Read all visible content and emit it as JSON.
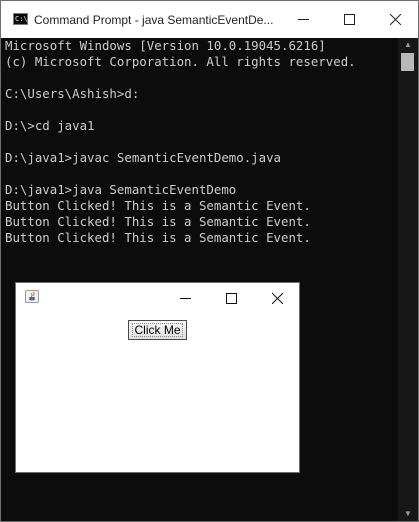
{
  "cmd_window": {
    "title": "Command Prompt - java  SemanticEventDe...",
    "icon": "cmd-icon",
    "console_lines": [
      "Microsoft Windows [Version 10.0.19045.6216]",
      "(c) Microsoft Corporation. All rights reserved.",
      "",
      "C:\\Users\\Ashish>d:",
      "",
      "D:\\>cd java1",
      "",
      "D:\\java1>javac SemanticEventDemo.java",
      "",
      "D:\\java1>java SemanticEventDemo",
      "Button Clicked! This is a Semantic Event.",
      "Button Clicked! This is a Semantic Event.",
      "Button Clicked! This is a Semantic Event."
    ]
  },
  "java_frame": {
    "icon": "java-icon",
    "button_label": "Click Me"
  },
  "colors": {
    "console_bg": "#0c0c0c",
    "console_text": "#cccccc",
    "titlebar_bg": "#ffffff"
  }
}
